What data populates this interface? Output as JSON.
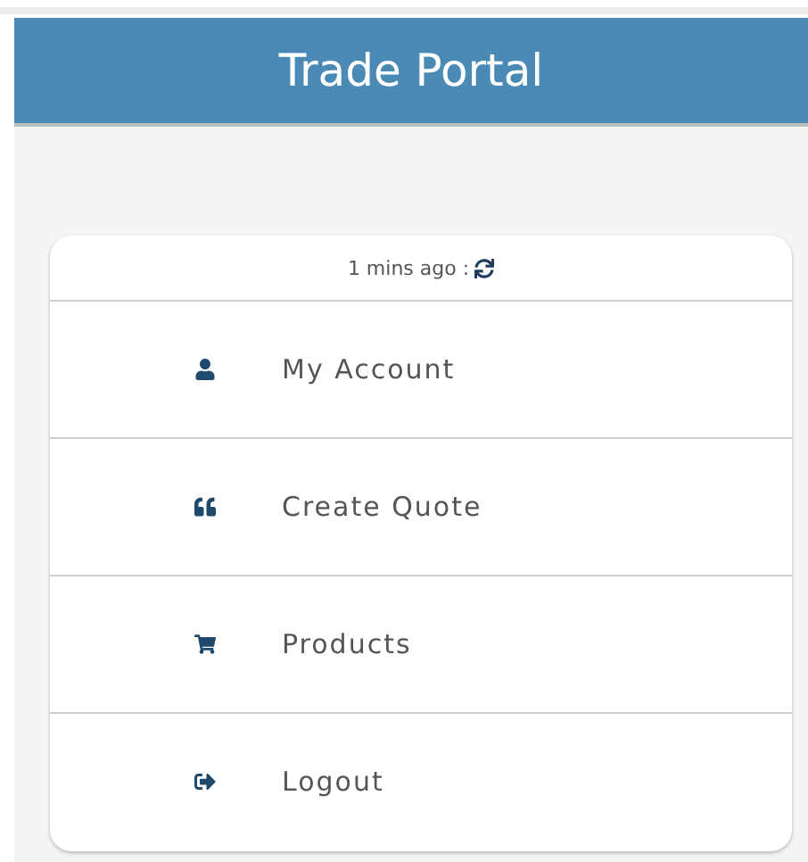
{
  "header": {
    "title": "Trade Portal"
  },
  "status": {
    "text": "1 mins ago :"
  },
  "menu": [
    {
      "kind": "account",
      "label": "My Account"
    },
    {
      "kind": "quote",
      "label": "Create Quote"
    },
    {
      "kind": "cart",
      "label": "Products"
    },
    {
      "kind": "logout",
      "label": "Logout"
    }
  ]
}
